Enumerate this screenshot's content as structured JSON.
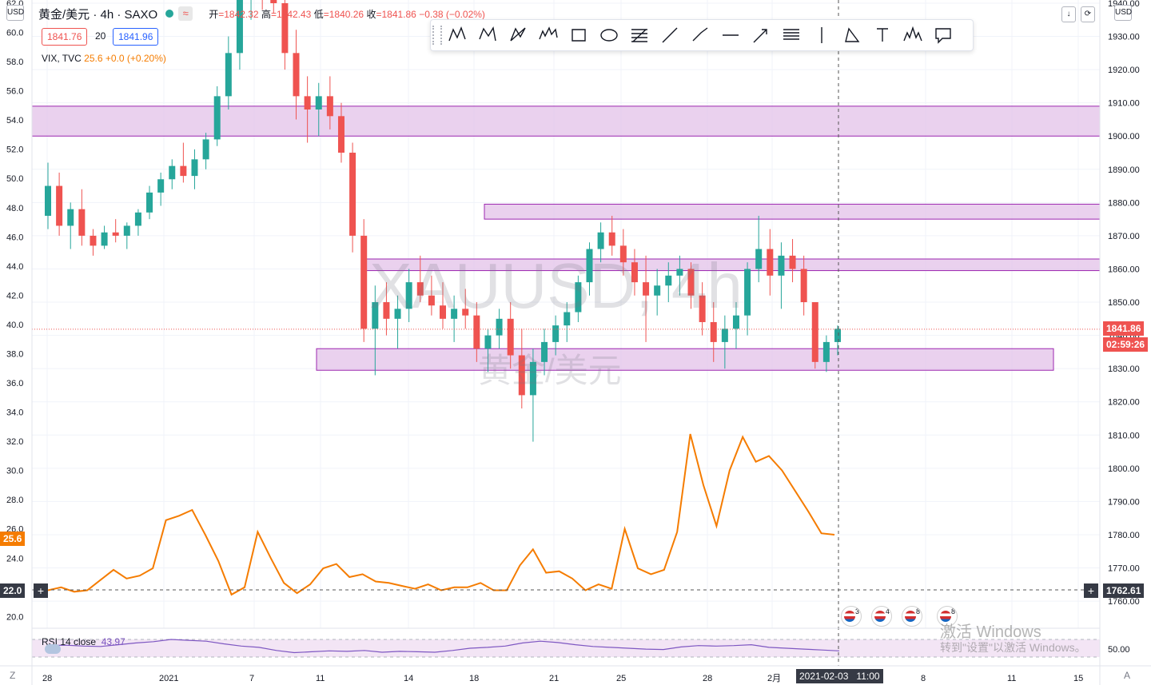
{
  "header": {
    "symbol": "黄金/美元 · 4h · SAXO",
    "wave_icon": "≈",
    "open_label": "开",
    "open": "=1842.32",
    "high_label": "高",
    "high": "=1842.43",
    "low_label": "低",
    "low": "=1840.26",
    "close_label": "收",
    "close": "=1841.86",
    "change": "−0.38 (−0.02%)",
    "bid": "1841.76",
    "spread": "20",
    "ask": "1841.96"
  },
  "indicator": {
    "name": "VIX, TVC",
    "value": "25.6",
    "change": "+0.0 (+0.20%)"
  },
  "rsi": {
    "label": "RSI 14 close",
    "value": "43.97",
    "axis_label": "50.00"
  },
  "currency_left": "USD",
  "currency_right": "USD",
  "watermark": {
    "symbol": "XAUUSD, 4h",
    "name": "黄金/美元"
  },
  "windows_activation": {
    "line1": "激活 Windows",
    "line2": "转到\"设置\"以激活 Windows。"
  },
  "price_tags": {
    "last": "1841.86",
    "countdown": "02:59:26",
    "crosshair": "1762.61",
    "vix_last": "25.6",
    "vix_cross": "22.0"
  },
  "crosshair_date": "2021-02-03",
  "crosshair_time": "11:00",
  "events": [
    "3",
    "4",
    "8",
    "8"
  ],
  "bottom_left": "Z",
  "bottom_right": "A",
  "toolbar_tools": [
    "xabcd-pattern-icon",
    "cypher-pattern-icon",
    "abcd-pattern-icon",
    "elliott-wave-icon",
    "rectangle-icon",
    "ellipse-icon",
    "fib-retracement-icon",
    "trend-line-icon",
    "ray-icon",
    "horizontal-line-icon",
    "arrow-icon",
    "parallel-channel-icon",
    "vertical-line-icon",
    "triangle-icon",
    "text-icon",
    "head-shoulders-icon",
    "callout-icon"
  ],
  "colors": {
    "up": "#26a69a",
    "down": "#ef5350",
    "vix": "#f57c00",
    "zone": "#e1bee7",
    "zone_border": "#9c27b0",
    "rsi": "#7e57c2"
  },
  "chart_data": {
    "type": "line",
    "x_tick_labels": [
      "28",
      "2021",
      "7",
      "11",
      "14",
      "18",
      "21",
      "25",
      "28",
      "2月",
      "8",
      "11",
      "15"
    ],
    "right_axis": {
      "label": "USD",
      "ticks": [
        "1940.00",
        "1930.00",
        "1920.00",
        "1910.00",
        "1900.00",
        "1890.00",
        "1880.00",
        "1870.00",
        "1860.00",
        "1850.00",
        "1840.00",
        "1830.00",
        "1820.00",
        "1810.00",
        "1800.00",
        "1790.00",
        "1780.00",
        "1770.00",
        "1760.00"
      ]
    },
    "left_axis": {
      "label": "USD",
      "ticks": [
        "62.0",
        "60.0",
        "58.0",
        "56.0",
        "54.0",
        "52.0",
        "50.0",
        "48.0",
        "46.0",
        "44.0",
        "42.0",
        "40.0",
        "38.0",
        "36.0",
        "34.0",
        "32.0",
        "30.0",
        "28.0",
        "26.0",
        "24.0",
        "22.0",
        "20.0"
      ]
    },
    "zones": [
      {
        "from": 1900,
        "to": 1909,
        "name": ""
      },
      {
        "from": 1875,
        "to": 1879.5,
        "name": ""
      },
      {
        "from": 1859.5,
        "to": 1863,
        "name": ""
      },
      {
        "from": 1829.5,
        "to": 1836,
        "name": ""
      }
    ],
    "series": [
      {
        "name": "XAUUSD 4h",
        "type": "candlestick",
        "ohlc": [
          [
            1876,
            1892,
            1872,
            1885
          ],
          [
            1885,
            1889,
            1870,
            1873
          ],
          [
            1873,
            1880,
            1866,
            1878
          ],
          [
            1878,
            1884,
            1867,
            1870
          ],
          [
            1870,
            1872,
            1864,
            1867
          ],
          [
            1867,
            1873,
            1866,
            1871
          ],
          [
            1871,
            1875,
            1868,
            1870
          ],
          [
            1870,
            1874,
            1866,
            1873
          ],
          [
            1873,
            1878,
            1870,
            1877
          ],
          [
            1877,
            1885,
            1875,
            1883
          ],
          [
            1883,
            1889,
            1879,
            1887
          ],
          [
            1887,
            1893,
            1884,
            1891
          ],
          [
            1891,
            1898,
            1886,
            1888
          ],
          [
            1888,
            1896,
            1884,
            1893
          ],
          [
            1893,
            1901,
            1890,
            1899
          ],
          [
            1899,
            1915,
            1897,
            1912
          ],
          [
            1912,
            1930,
            1908,
            1925
          ],
          [
            1925,
            1945,
            1920,
            1942
          ],
          [
            1942,
            1952,
            1935,
            1948
          ],
          [
            1948,
            1956,
            1938,
            1944
          ],
          [
            1944,
            1950,
            1937,
            1940
          ],
          [
            1940,
            1942,
            1920,
            1925
          ],
          [
            1925,
            1932,
            1905,
            1912
          ],
          [
            1912,
            1918,
            1898,
            1908
          ],
          [
            1908,
            1916,
            1900,
            1912
          ],
          [
            1912,
            1918,
            1902,
            1906
          ],
          [
            1906,
            1910,
            1892,
            1895
          ],
          [
            1895,
            1898,
            1865,
            1870
          ],
          [
            1870,
            1875,
            1838,
            1842
          ],
          [
            1842,
            1855,
            1828,
            1850
          ],
          [
            1850,
            1856,
            1840,
            1845
          ],
          [
            1845,
            1852,
            1836,
            1848
          ],
          [
            1848,
            1860,
            1844,
            1856
          ],
          [
            1856,
            1864,
            1850,
            1852
          ],
          [
            1852,
            1858,
            1846,
            1849
          ],
          [
            1849,
            1856,
            1842,
            1845
          ],
          [
            1845,
            1852,
            1838,
            1848
          ],
          [
            1848,
            1854,
            1842,
            1846
          ],
          [
            1846,
            1850,
            1832,
            1836
          ],
          [
            1836,
            1842,
            1829,
            1840
          ],
          [
            1840,
            1848,
            1836,
            1845
          ],
          [
            1845,
            1850,
            1830,
            1834
          ],
          [
            1834,
            1842,
            1818,
            1822
          ],
          [
            1822,
            1836,
            1808,
            1832
          ],
          [
            1832,
            1842,
            1828,
            1838
          ],
          [
            1838,
            1846,
            1834,
            1843
          ],
          [
            1843,
            1850,
            1838,
            1847
          ],
          [
            1847,
            1858,
            1844,
            1856
          ],
          [
            1856,
            1868,
            1852,
            1866
          ],
          [
            1866,
            1874,
            1862,
            1871
          ],
          [
            1871,
            1876,
            1864,
            1867
          ],
          [
            1867,
            1872,
            1858,
            1862
          ],
          [
            1862,
            1866,
            1852,
            1856
          ],
          [
            1856,
            1864,
            1838,
            1852
          ],
          [
            1852,
            1860,
            1846,
            1855
          ],
          [
            1855,
            1862,
            1850,
            1858
          ],
          [
            1858,
            1864,
            1852,
            1860
          ],
          [
            1860,
            1862,
            1848,
            1852
          ],
          [
            1852,
            1856,
            1840,
            1844
          ],
          [
            1844,
            1850,
            1832,
            1838
          ],
          [
            1838,
            1846,
            1830,
            1842
          ],
          [
            1842,
            1850,
            1836,
            1846
          ],
          [
            1846,
            1862,
            1840,
            1860
          ],
          [
            1860,
            1876,
            1856,
            1866
          ],
          [
            1866,
            1872,
            1852,
            1858
          ],
          [
            1858,
            1868,
            1848,
            1864
          ],
          [
            1864,
            1869,
            1856,
            1860
          ],
          [
            1860,
            1864,
            1846,
            1850
          ],
          [
            1850,
            1846,
            1830,
            1832
          ],
          [
            1832,
            1840,
            1829,
            1838
          ],
          [
            1838,
            1843,
            1834,
            1842
          ]
        ]
      },
      {
        "name": "VIX",
        "axis": "left",
        "values": [
          21.8,
          22.0,
          21.7,
          21.8,
          22.5,
          23.2,
          22.6,
          22.8,
          23.3,
          26.6,
          26.9,
          27.3,
          25.6,
          23.8,
          21.5,
          22.0,
          25.8,
          24.0,
          22.3,
          21.6,
          22.2,
          23.3,
          23.6,
          22.7,
          22.9,
          22.4,
          22.3,
          22.1,
          21.9,
          22.2,
          21.8,
          22.0,
          22.0,
          22.3,
          21.8,
          21.8,
          23.5,
          24.6,
          23.0,
          23.1,
          22.6,
          21.8,
          22.2,
          21.9,
          26.0,
          23.3,
          22.9,
          23.2,
          25.8,
          32.5,
          29.0,
          26.2,
          30.0,
          32.3,
          30.6,
          31.0,
          30.0,
          28.6,
          27.2,
          25.7,
          25.6
        ]
      },
      {
        "name": "RSI 14 close",
        "axis": "rsi",
        "values": [
          56,
          57,
          55,
          54,
          58,
          62,
          65,
          70,
          68,
          66,
          60,
          55,
          52,
          45,
          40,
          42,
          44,
          43,
          45,
          41,
          43,
          42,
          41,
          45,
          50,
          52,
          55,
          62,
          66,
          63,
          58,
          54,
          52,
          50,
          48,
          47,
          53,
          56,
          55,
          56,
          58,
          52,
          50,
          48,
          46,
          43.97
        ]
      }
    ]
  }
}
